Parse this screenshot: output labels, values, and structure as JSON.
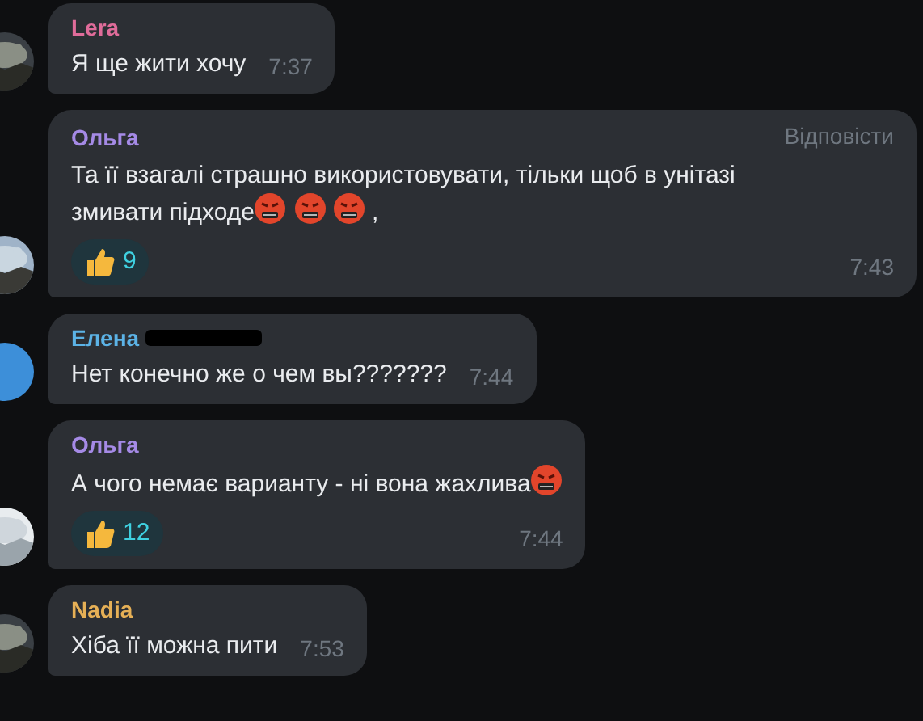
{
  "messages": [
    {
      "author": "Lera",
      "color": "#e06c9a",
      "avatar": {
        "kind": "picture"
      },
      "segments": [
        {
          "kind": "text",
          "text": "Я ще жити хочу"
        }
      ],
      "time": "7:37"
    },
    {
      "author": "Ольга",
      "color": "#a58ae6",
      "avatar": {
        "kind": "picture"
      },
      "reply_label": "Відповісти",
      "segments": [
        {
          "kind": "line",
          "text": "Та її взагалі страшно використовувати, тільки щоб в унітазі"
        },
        {
          "kind": "text",
          "text": "змивати підходе"
        },
        {
          "kind": "emoji"
        },
        {
          "kind": "emoji"
        },
        {
          "kind": "emoji"
        },
        {
          "kind": "text",
          "text": ","
        }
      ],
      "reactions": [
        {
          "count": "9"
        }
      ],
      "time": "7:43"
    },
    {
      "author": "Елена",
      "color": "#5cb3e6",
      "redacted": true,
      "avatar": {
        "kind": "initial",
        "color": "#3d8fd9"
      },
      "segments": [
        {
          "kind": "text",
          "text": "Нет конечно же о чем вы???????"
        }
      ],
      "time": "7:44"
    },
    {
      "author": "Ольга",
      "color": "#a58ae6",
      "avatar": {
        "kind": "picture"
      },
      "segments": [
        {
          "kind": "text",
          "text": "А чого немає варианту - ні вона жахлива"
        },
        {
          "kind": "emoji"
        }
      ],
      "reactions": [
        {
          "count": "12"
        }
      ],
      "time": "7:44"
    },
    {
      "author": "Nadia",
      "color": "#e6b056",
      "avatar": {
        "kind": "picture"
      },
      "segments": [
        {
          "kind": "text",
          "text": "Хіба її можна пити"
        }
      ],
      "time": "7:53"
    }
  ]
}
